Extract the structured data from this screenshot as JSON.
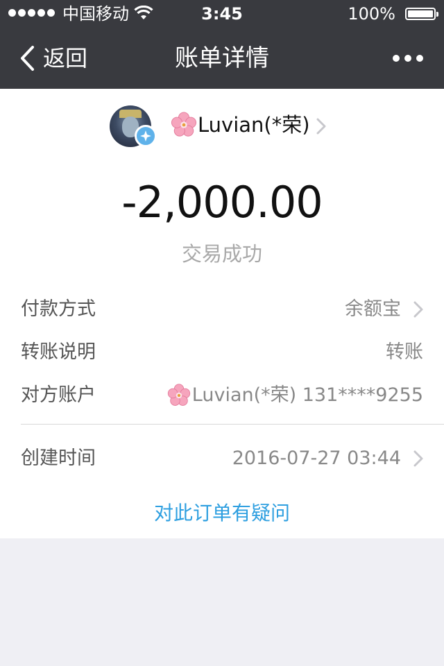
{
  "status_bar": {
    "carrier": "中国移动",
    "time": "3:45",
    "battery": "100%"
  },
  "nav": {
    "back_label": "返回",
    "title": "账单详情"
  },
  "payee": {
    "name": "Luvian(*荣)"
  },
  "amount": "-2,000.00",
  "transaction_status": "交易成功",
  "details": {
    "payment_method": {
      "label": "付款方式",
      "value": "余额宝"
    },
    "transfer_note": {
      "label": "转账说明",
      "value": "转账"
    },
    "counterparty": {
      "label": "对方账户",
      "value": "Luvian(*荣) 131****9255"
    },
    "created_time": {
      "label": "创建时间",
      "value": "2016-07-27 03:44"
    }
  },
  "dispute_link": "对此订单有疑问",
  "colors": {
    "header_bg": "#393a3f",
    "page_bg": "#efeff4",
    "link": "#2e9fe0",
    "verified_badge": "#5fb2ea"
  }
}
